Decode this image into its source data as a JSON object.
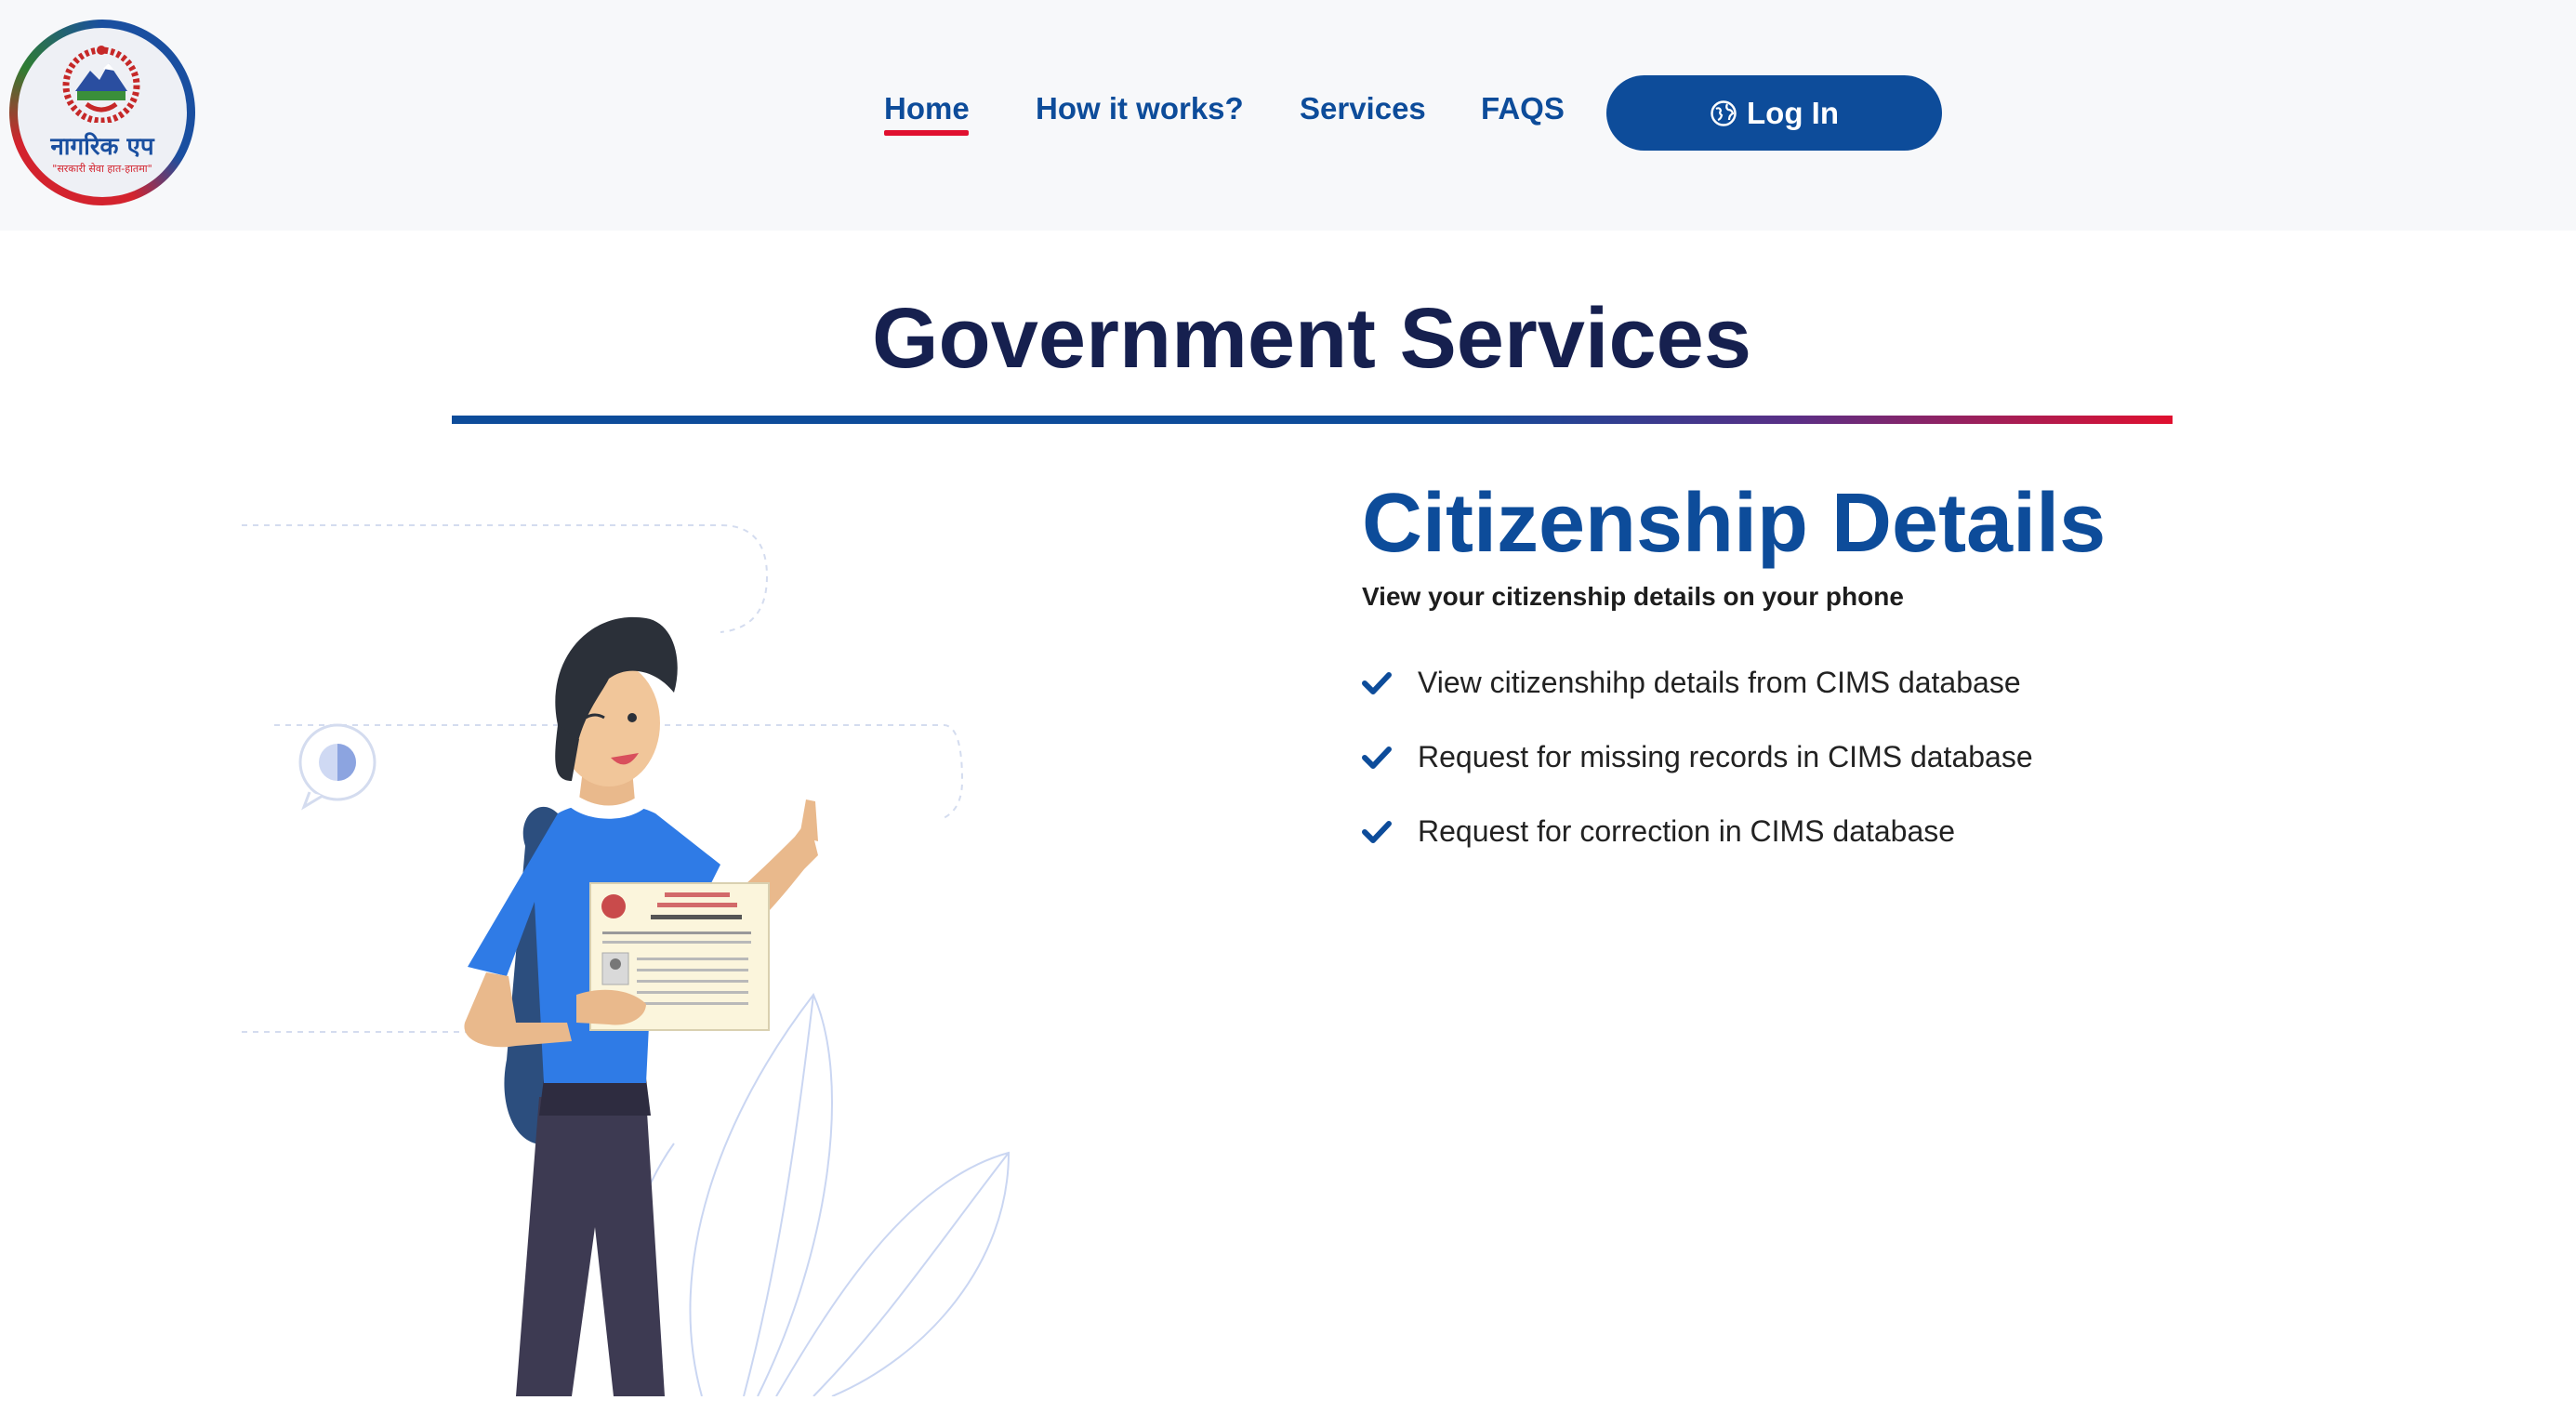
{
  "header": {
    "logo": {
      "title": "नागरिक एप",
      "tagline": "\"सरकारी सेवा हात-हातमा\""
    },
    "nav": [
      {
        "label": "Home",
        "active": true
      },
      {
        "label": "How it works?"
      },
      {
        "label": "Services"
      },
      {
        "label": "FAQS"
      }
    ],
    "login": {
      "label": "Log In",
      "icon": "globe-icon"
    }
  },
  "main": {
    "title": "Government Services",
    "service": {
      "title": "Citizenship Details",
      "subtitle": "View your citizenship details on your phone",
      "features": [
        "View citizenshihp details from CIMS database",
        "Request for missing records in CIMS database",
        "Request for correction in CIMS database"
      ]
    }
  },
  "colors": {
    "primary": "#0d4c9a",
    "heading": "#16204f",
    "accent": "#e0102f",
    "header_bg": "#f7f8fa"
  }
}
